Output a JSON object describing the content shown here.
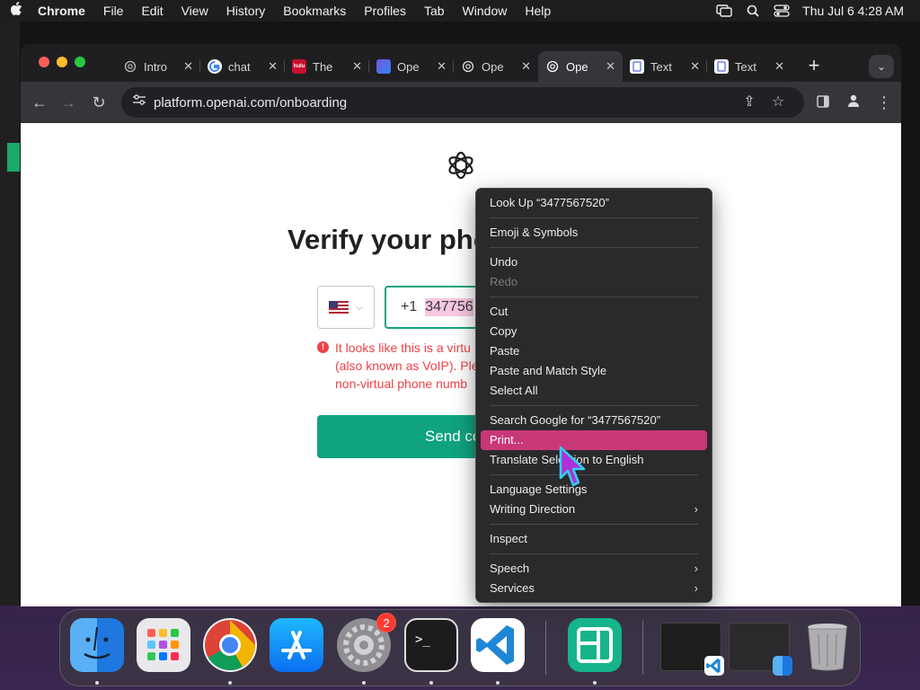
{
  "menubar": {
    "app": "Chrome",
    "items": [
      "File",
      "Edit",
      "View",
      "History",
      "Bookmarks",
      "Profiles",
      "Tab",
      "Window",
      "Help"
    ],
    "clock": "Thu Jul 6  4:28 AM"
  },
  "browser": {
    "tabs": [
      {
        "title": "Intro",
        "icon": "openai-icon"
      },
      {
        "title": "chat",
        "icon": "google-icon"
      },
      {
        "title": "The",
        "icon": "hulu-icon"
      },
      {
        "title": "Ope",
        "icon": "app-icon"
      },
      {
        "title": "Ope",
        "icon": "openai-icon"
      },
      {
        "title": "Ope",
        "icon": "openai-icon",
        "active": true
      },
      {
        "title": "Text",
        "icon": "doc-icon"
      },
      {
        "title": "Text",
        "icon": "doc-icon"
      }
    ],
    "url": "platform.openai.com/onboarding"
  },
  "page": {
    "heading": "Verify your pho",
    "country_code": "+1",
    "phone_value": "347756",
    "error_lines": [
      "It looks like this is a virtu",
      "(also known as VoIP). Ple",
      "non-virtual phone numb"
    ],
    "send_button": "Send co"
  },
  "context_menu": {
    "groups": [
      [
        {
          "label": "Look Up “3477567520”"
        }
      ],
      [
        {
          "label": "Emoji & Symbols"
        }
      ],
      [
        {
          "label": "Undo"
        },
        {
          "label": "Redo",
          "disabled": true
        }
      ],
      [
        {
          "label": "Cut"
        },
        {
          "label": "Copy"
        },
        {
          "label": "Paste"
        },
        {
          "label": "Paste and Match Style"
        },
        {
          "label": "Select All"
        }
      ],
      [
        {
          "label": "Search Google for “3477567520”"
        },
        {
          "label": "Print...",
          "highlight": true
        },
        {
          "label": "Translate Selection to English"
        }
      ],
      [
        {
          "label": "Language Settings"
        },
        {
          "label": "Writing Direction",
          "submenu": true
        }
      ],
      [
        {
          "label": "Inspect"
        }
      ],
      [
        {
          "label": "Speech",
          "submenu": true
        },
        {
          "label": "Services",
          "submenu": true
        }
      ]
    ]
  },
  "dock": {
    "apps": [
      "finder",
      "launchpad",
      "chrome",
      "app-store",
      "system-settings",
      "terminal",
      "vscode",
      "app"
    ],
    "settings_badge": "2"
  },
  "colors": {
    "accent_green": "#10a37f",
    "error_red": "#ef4146",
    "menu_highlight": "#c93876",
    "selection_pink": "#f8c7e0"
  }
}
